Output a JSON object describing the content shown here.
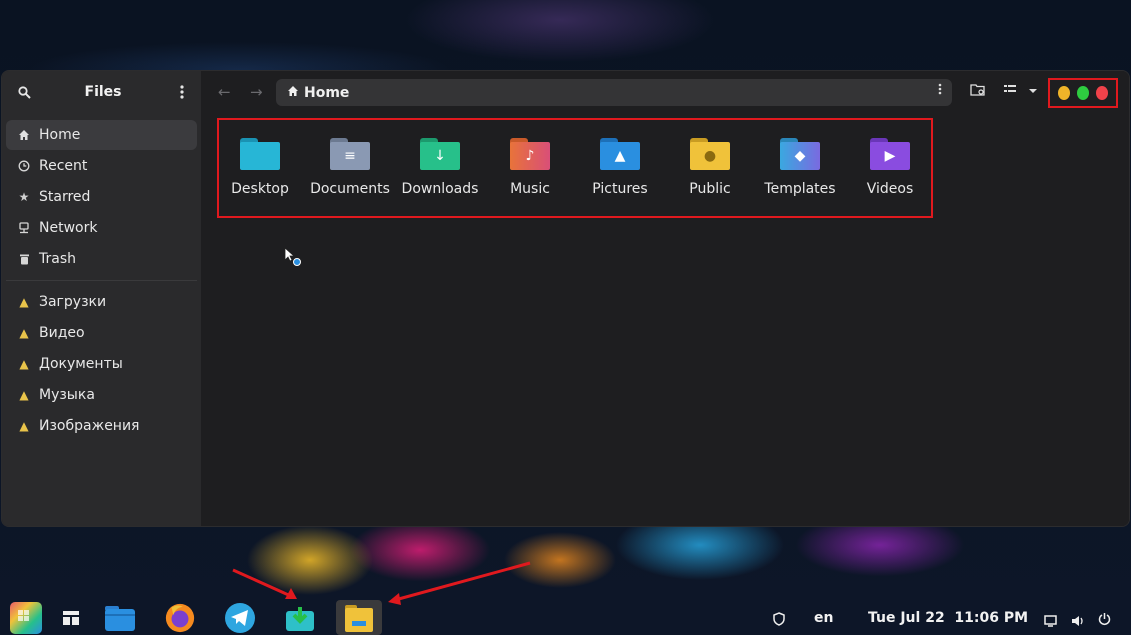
{
  "window": {
    "sidebar_title": "Files",
    "sidebar_items": [
      {
        "label": "Home",
        "icon": "home-icon",
        "active": true
      },
      {
        "label": "Recent",
        "icon": "clock-icon"
      },
      {
        "label": "Starred",
        "icon": "star-icon"
      },
      {
        "label": "Network",
        "icon": "network-icon"
      },
      {
        "label": "Trash",
        "icon": "trash-icon"
      }
    ],
    "bookmarks": [
      {
        "label": "Загрузки",
        "icon": "warning-icon"
      },
      {
        "label": "Видео",
        "icon": "warning-icon"
      },
      {
        "label": "Документы",
        "icon": "warning-icon"
      },
      {
        "label": "Музыка",
        "icon": "warning-icon"
      },
      {
        "label": "Изображения",
        "icon": "warning-icon"
      }
    ],
    "path": {
      "crumb": "Home"
    },
    "window_buttons": {
      "minimize_color": "#f0b429",
      "maximize_color": "#2ecc40",
      "close_color": "#f0424a"
    },
    "folders": [
      {
        "label": "Desktop",
        "color": "#27b6d6",
        "icon": "desktop-folder-icon"
      },
      {
        "label": "Documents",
        "color": "#8a99b3",
        "icon": "documents-folder-icon"
      },
      {
        "label": "Downloads",
        "color": "#27c08a",
        "icon": "downloads-folder-icon"
      },
      {
        "label": "Music",
        "color": "#e8733a",
        "icon": "music-folder-icon"
      },
      {
        "label": "Pictures",
        "color": "#2a8fe0",
        "icon": "pictures-folder-icon"
      },
      {
        "label": "Public",
        "color": "#f0c23a",
        "icon": "public-folder-icon"
      },
      {
        "label": "Templates",
        "color": "#3aa8e0",
        "icon": "templates-folder-icon"
      },
      {
        "label": "Videos",
        "color": "#8a4ce0",
        "icon": "videos-folder-icon"
      }
    ]
  },
  "taskbar": {
    "lang": "en",
    "datetime": "Tue Jul 22  11:06 PM"
  }
}
